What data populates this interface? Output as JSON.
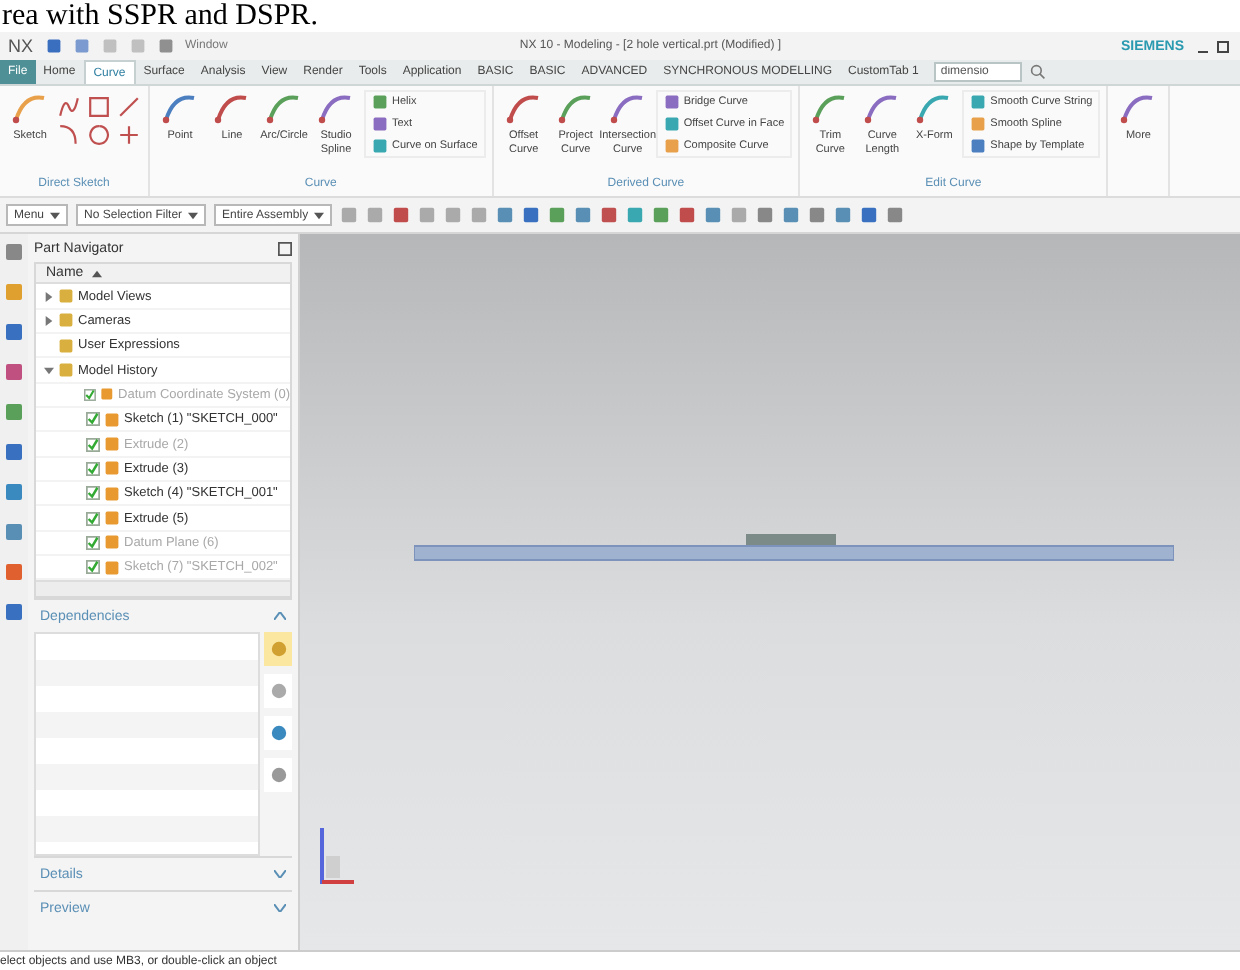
{
  "caption_fragment": "rea with SSPR and DSPR.",
  "title_bar": {
    "app": "NX",
    "window_menu": "Window",
    "title": "NX 10 - Modeling - [2 hole vertical.prt (Modified) ]",
    "brand": "SIEMENS"
  },
  "ribbon_tabs": [
    {
      "label": "File",
      "kind": "file",
      "selected": false
    },
    {
      "label": "Home",
      "kind": "tab",
      "selected": false
    },
    {
      "label": "Curve",
      "kind": "tab",
      "selected": true
    },
    {
      "label": "Surface",
      "kind": "tab",
      "selected": false
    },
    {
      "label": "Analysis",
      "kind": "tab",
      "selected": false
    },
    {
      "label": "View",
      "kind": "tab",
      "selected": false
    },
    {
      "label": "Render",
      "kind": "tab",
      "selected": false
    },
    {
      "label": "Tools",
      "kind": "tab",
      "selected": false
    },
    {
      "label": "Application",
      "kind": "tab",
      "selected": false
    },
    {
      "label": "BASIC",
      "kind": "tab",
      "selected": false
    },
    {
      "label": "BASIC",
      "kind": "tab",
      "selected": false
    },
    {
      "label": "ADVANCED",
      "kind": "tab",
      "selected": false
    },
    {
      "label": "SYNCHRONOUS MODELLING",
      "kind": "tab",
      "selected": false
    },
    {
      "label": "CustomTab 1",
      "kind": "tab",
      "selected": false
    }
  ],
  "command_search": {
    "value": "dimensio"
  },
  "ribbon_groups": [
    {
      "label": "Direct Sketch",
      "commands": [
        {
          "label": "Sketch",
          "kind": "large"
        },
        {
          "kind": "grid"
        }
      ]
    },
    {
      "label": "Curve",
      "commands": [
        {
          "label": "Point",
          "kind": "large"
        },
        {
          "label": "Line",
          "kind": "large"
        },
        {
          "label": "Arc/Circle",
          "kind": "large"
        },
        {
          "label": "Studio Spline",
          "kind": "large"
        },
        {
          "label": "Helix",
          "kind": "small"
        },
        {
          "label": "Text",
          "kind": "small"
        },
        {
          "label": "Curve on Surface",
          "kind": "small"
        }
      ]
    },
    {
      "label": "Derived Curve",
      "commands": [
        {
          "label": "Offset Curve",
          "kind": "large"
        },
        {
          "label": "Project Curve",
          "kind": "large"
        },
        {
          "label": "Intersection Curve",
          "kind": "large"
        },
        {
          "label": "Bridge Curve",
          "kind": "small"
        },
        {
          "label": "Offset Curve in Face",
          "kind": "small"
        },
        {
          "label": "Composite Curve",
          "kind": "small"
        }
      ]
    },
    {
      "label": "Edit Curve",
      "commands": [
        {
          "label": "Trim Curve",
          "kind": "large"
        },
        {
          "label": "Curve Length",
          "kind": "large"
        },
        {
          "label": "X-Form",
          "kind": "large"
        },
        {
          "label": "Smooth Curve String",
          "kind": "small"
        },
        {
          "label": "Smooth Spline",
          "kind": "small"
        },
        {
          "label": "Shape by Template",
          "kind": "small"
        }
      ]
    },
    {
      "commands": [
        {
          "label": "More",
          "kind": "large"
        }
      ]
    }
  ],
  "toolbar": {
    "menu": "Menu",
    "selection_filter": "No Selection Filter",
    "scope": "Entire Assembly"
  },
  "part_navigator": {
    "title": "Part Navigator",
    "column": "Name",
    "tree": [
      {
        "label": "Model Views",
        "expanded": false
      },
      {
        "label": "Cameras",
        "expanded": false
      },
      {
        "label": "User Expressions"
      },
      {
        "label": "Model History",
        "expanded": true,
        "children": [
          {
            "label": "Datum Coordinate System (0)",
            "checked": true,
            "greyed": true
          },
          {
            "label": "Sketch (1) \"SKETCH_000\"",
            "checked": true,
            "greyed": false
          },
          {
            "label": "Extrude (2)",
            "checked": true,
            "greyed": true
          },
          {
            "label": "Extrude (3)",
            "checked": true,
            "greyed": false
          },
          {
            "label": "Sketch (4) \"SKETCH_001\"",
            "checked": true,
            "greyed": false
          },
          {
            "label": "Extrude (5)",
            "checked": true,
            "greyed": false
          },
          {
            "label": "Datum Plane (6)",
            "checked": true,
            "greyed": true
          },
          {
            "label": "Sketch (7) \"SKETCH_002\"",
            "checked": true,
            "greyed": true
          }
        ]
      }
    ]
  },
  "panels": [
    {
      "label": "Dependencies",
      "expanded": true
    },
    {
      "label": "Details",
      "expanded": false
    },
    {
      "label": "Preview",
      "expanded": false
    }
  ],
  "status_bar": {
    "prompt": "elect objects and use MB3, or double-click an object"
  }
}
